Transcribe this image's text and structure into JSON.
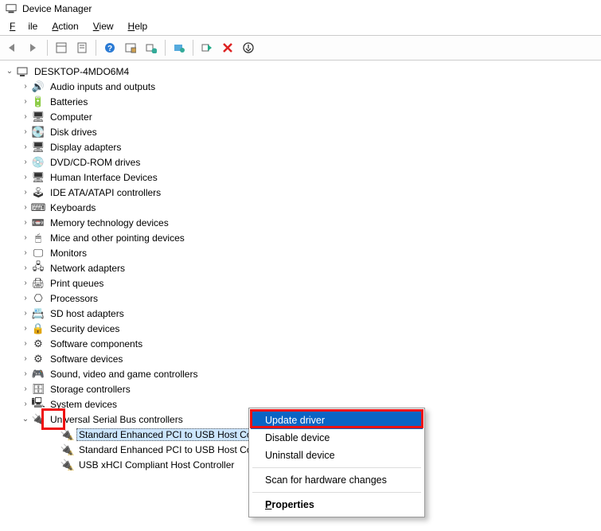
{
  "window": {
    "title": "Device Manager"
  },
  "menu": {
    "file": "File",
    "action": "Action",
    "view": "View",
    "help": "Help"
  },
  "root": {
    "name": "DESKTOP-4MDO6M4"
  },
  "categories": [
    {
      "label": "Audio inputs and outputs",
      "icon": "🔊"
    },
    {
      "label": "Batteries",
      "icon": "🔋"
    },
    {
      "label": "Computer",
      "icon": "🖥"
    },
    {
      "label": "Disk drives",
      "icon": "💽"
    },
    {
      "label": "Display adapters",
      "icon": "🖥"
    },
    {
      "label": "DVD/CD-ROM drives",
      "icon": "💿"
    },
    {
      "label": "Human Interface Devices",
      "icon": "🖥"
    },
    {
      "label": "IDE ATA/ATAPI controllers",
      "icon": "🕹"
    },
    {
      "label": "Keyboards",
      "icon": "⌨"
    },
    {
      "label": "Memory technology devices",
      "icon": "📼"
    },
    {
      "label": "Mice and other pointing devices",
      "icon": "🖱"
    },
    {
      "label": "Monitors",
      "icon": "🖵"
    },
    {
      "label": "Network adapters",
      "icon": "🖧"
    },
    {
      "label": "Print queues",
      "icon": "🖨"
    },
    {
      "label": "Processors",
      "icon": "⎔"
    },
    {
      "label": "SD host adapters",
      "icon": "📇"
    },
    {
      "label": "Security devices",
      "icon": "🔒"
    },
    {
      "label": "Software components",
      "icon": "⚙"
    },
    {
      "label": "Software devices",
      "icon": "⚙"
    },
    {
      "label": "Sound, video and game controllers",
      "icon": "🎮"
    },
    {
      "label": "Storage controllers",
      "icon": "🗄"
    },
    {
      "label": "System devices",
      "icon": "🖳"
    },
    {
      "label": "Universal Serial Bus controllers",
      "icon": "🔌",
      "expanded": true
    }
  ],
  "usb_children": [
    {
      "label": "Standard Enhanced PCI to USB Host Controller",
      "warn": true,
      "selected": true
    },
    {
      "label": "Standard Enhanced PCI to USB Host Cont",
      "warn": true
    },
    {
      "label": "USB xHCI Compliant Host Controller",
      "warn": true
    }
  ],
  "context_menu": {
    "items": [
      {
        "label": "Update driver",
        "highlight": true
      },
      {
        "label": "Disable device"
      },
      {
        "label": "Uninstall device"
      },
      {
        "sep": true
      },
      {
        "label": "Scan for hardware changes"
      },
      {
        "sep": true
      },
      {
        "label": "Properties",
        "bold": true
      }
    ]
  }
}
